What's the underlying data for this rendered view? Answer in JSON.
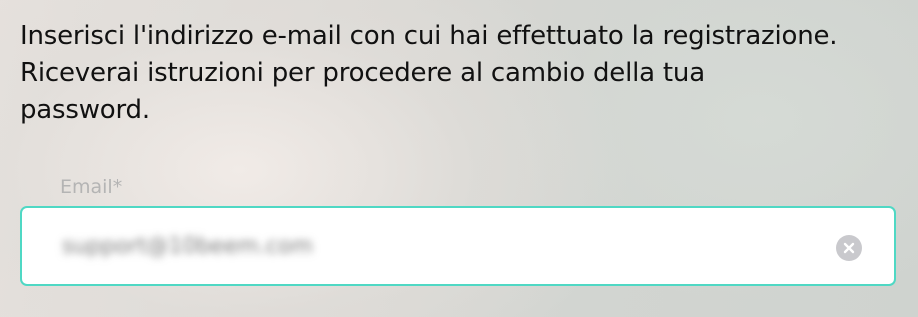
{
  "form": {
    "description": "Inserisci l'indirizzo e-mail con cui hai effettuato la registrazione.\nRiceverai istruzioni per procedere al cambio della tua\npassword.",
    "email_label": "Email*",
    "email_value": "support@10beem.com",
    "clear_icon": "clear-circle-x-icon"
  },
  "colors": {
    "input_border": "#4fd8c4",
    "clear_icon_bg": "#c9c9cd",
    "label_text": "#b4b4b4"
  }
}
